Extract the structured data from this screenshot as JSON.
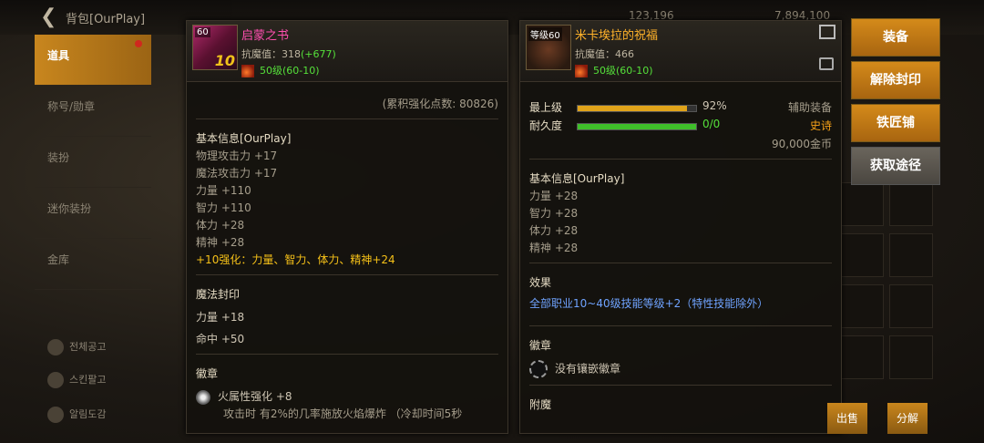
{
  "topbar": {
    "title": "背包[OurPlay]",
    "coins_a": "123,196",
    "coins_b": "7,894,100"
  },
  "sidebar": {
    "items": [
      {
        "label": "道具"
      },
      {
        "label": "称号/勋章"
      },
      {
        "label": "装扮"
      },
      {
        "label": "迷你装扮"
      },
      {
        "label": "金库"
      }
    ],
    "bottom": [
      {
        "label": "전체공고"
      },
      {
        "label": "스킨팔고"
      },
      {
        "label": "알림도감"
      }
    ]
  },
  "item1": {
    "level": "60",
    "name": "启蒙之书",
    "enhance": "10",
    "resist_label": "抗魔值：",
    "resist": "318",
    "resist_bonus": "(+677)",
    "level_req": "50级(60-10)",
    "accum": "(累积强化点数: 80826)",
    "basic_title": "基本信息[OurPlay]",
    "stats": [
      "物理攻击力 +17",
      "魔法攻击力 +17",
      "力量 +110",
      "智力 +110",
      "体力 +28",
      "精神 +28"
    ],
    "enhance_line": "+10强化：力量、智力、体力、精神+24",
    "seal_title": "魔法封印",
    "seal_stats": [
      "力量 +18",
      "命中 +50"
    ],
    "emblem_title": "徽章",
    "emblem": "火属性强化 +8",
    "emblem_desc": "攻击时 有2%的几率施放火焰爆炸 （冷却时间5秒"
  },
  "item2": {
    "level": "等级60",
    "name": "米卡埃拉的祝福",
    "resist_label": "抗魔值：",
    "resist": "466",
    "level_req": "50级(60-10)",
    "max_label": "最上级",
    "max_pct": "92%",
    "max_value": 0.92,
    "dur_label": "耐久度",
    "dur": "0/0",
    "dur_value": 1.0,
    "type": "辅助装备",
    "rarity": "史诗",
    "price": "90,000金币",
    "basic_title": "基本信息[OurPlay]",
    "stats": [
      "力量 +28",
      "智力 +28",
      "体力 +28",
      "精神 +28"
    ],
    "effect_title": "效果",
    "effect": "全部职业10~40级技能等级+2（特性技能除外）",
    "emblem_title": "徽章",
    "emblem": "没有镶嵌徽章",
    "enchant_title": "附魔"
  },
  "actions": {
    "equip": "装备",
    "unseal": "解除封印",
    "smith": "铁匠铺",
    "obtain": "获取途径"
  },
  "footer": {
    "sell": "出售",
    "decompose": "分解"
  },
  "colors": {
    "accent": "#c8861e",
    "pink": "#ff4fb0",
    "green": "#55e03a",
    "yellow": "#f5c018",
    "blue": "#6fa3ff"
  }
}
